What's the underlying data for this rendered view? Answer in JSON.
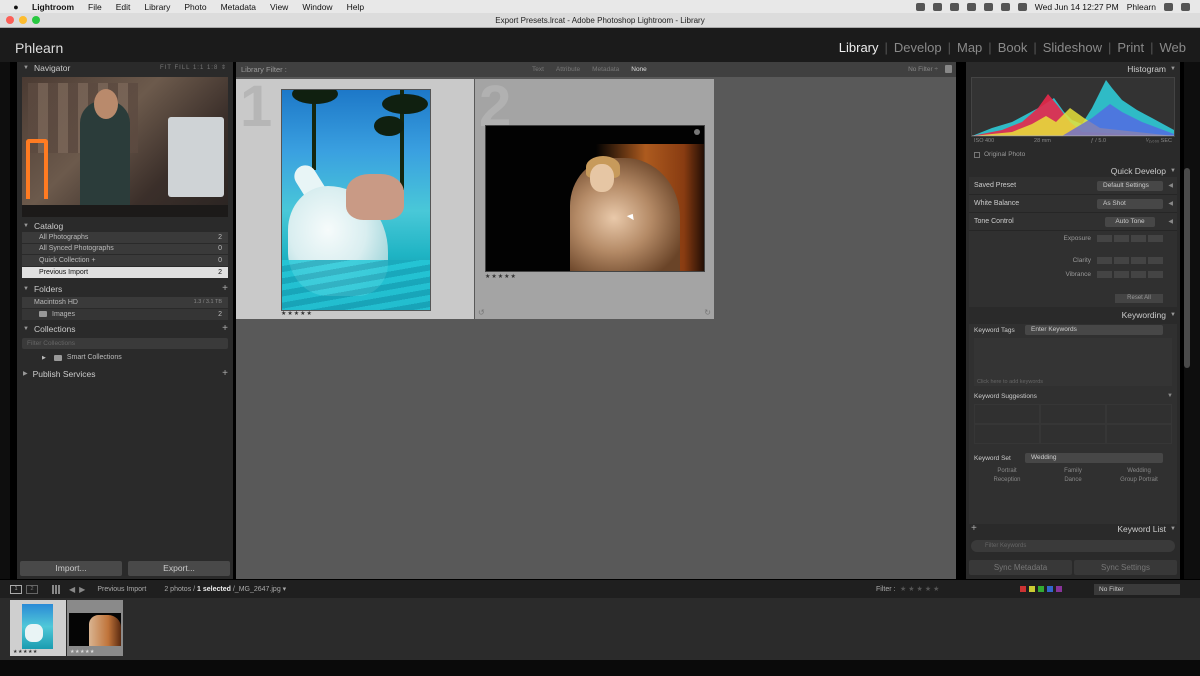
{
  "menubar": {
    "app": "Lightroom",
    "items": [
      "File",
      "Edit",
      "Library",
      "Photo",
      "Metadata",
      "View",
      "Window",
      "Help"
    ],
    "clock": "Wed Jun 14  12:27 PM",
    "user": "Phlearn"
  },
  "window": {
    "title": "Export Presets.lrcat - Adobe Photoshop Lightroom - Library"
  },
  "identity": {
    "logo": "Phlearn"
  },
  "modules": [
    "Library",
    "Develop",
    "Map",
    "Book",
    "Slideshow",
    "Print",
    "Web"
  ],
  "left": {
    "navigator": {
      "title": "Navigator",
      "options": "FIT  FILL  1:1  1:8 ⇕"
    },
    "catalog": {
      "title": "Catalog",
      "items": [
        {
          "label": "All Photographs",
          "count": "2"
        },
        {
          "label": "All Synced Photographs",
          "count": "0"
        },
        {
          "label": "Quick Collection +",
          "count": "0"
        },
        {
          "label": "Previous Import",
          "count": "2"
        }
      ]
    },
    "folders": {
      "title": "Folders",
      "volume": {
        "label": "Macintosh HD",
        "info": "1.3 / 3.1 TB"
      },
      "items": [
        {
          "label": "Images",
          "count": "2"
        }
      ]
    },
    "collections": {
      "title": "Collections",
      "search_placeholder": "Filter Collections",
      "items": [
        {
          "label": "Smart Collections"
        }
      ]
    },
    "publish": {
      "title": "Publish Services"
    },
    "import_label": "Import...",
    "export_label": "Export..."
  },
  "center": {
    "filter_label": "Library Filter :",
    "filter_options": [
      "Text",
      "Attribute",
      "Metadata",
      "None"
    ],
    "filter_active": "None",
    "no_filter": "No Filter ÷",
    "cells": [
      {
        "index": "1",
        "stars": "★★★★★"
      },
      {
        "index": "2",
        "stars": "★★★★★"
      }
    ]
  },
  "right": {
    "histogram": {
      "title": "Histogram",
      "iso": "ISO 400",
      "focal": "28 mm",
      "aperture": "ƒ / 5.0",
      "shutter": "¹⁄₂,₀₀₀ SEC",
      "original_photo": "Original Photo"
    },
    "quick_develop": {
      "title": "Quick Develop",
      "saved_preset_label": "Saved Preset",
      "saved_preset_value": "Default Settings",
      "white_balance_label": "White Balance",
      "white_balance_value": "As Shot",
      "tone_control_label": "Tone Control",
      "auto_tone": "Auto Tone",
      "sliders": [
        "Exposure",
        "Clarity",
        "Vibrance"
      ],
      "reset": "Reset All"
    },
    "keywording": {
      "title": "Keywording",
      "tags_label": "Keyword Tags",
      "tags_value": "Enter Keywords",
      "add_placeholder": "Click here to add keywords",
      "suggestions_label": "Keyword Suggestions",
      "set_label": "Keyword Set",
      "set_value": "Wedding",
      "set_items": [
        "Portrait",
        "Family",
        "Wedding",
        "Reception",
        "Dance",
        "Group Portrait"
      ]
    },
    "keyword_list": {
      "title": "Keyword List",
      "search_placeholder": "Filter Keywords"
    },
    "sync_metadata": "Sync Metadata",
    "sync_settings": "Sync Settings"
  },
  "filmstrip": {
    "source": "Previous Import",
    "count_prefix": "2 photos / ",
    "count_selected": "1 selected",
    "filename": " /_MG_2647.jpg ▾",
    "filter_label": "Filter :",
    "filter_stars": "★★★★★",
    "filter_value": "No Filter",
    "thumbs": [
      {
        "stars": "★★★★★"
      },
      {
        "stars": "★★★★★"
      }
    ]
  },
  "colors": {
    "panel": "#2a2a2a",
    "grid_bg": "#595959",
    "selected_cell": "#c9c9c9",
    "traffic_red": "#fc5f57",
    "traffic_yellow": "#fdbc2e",
    "traffic_green": "#28c840"
  }
}
